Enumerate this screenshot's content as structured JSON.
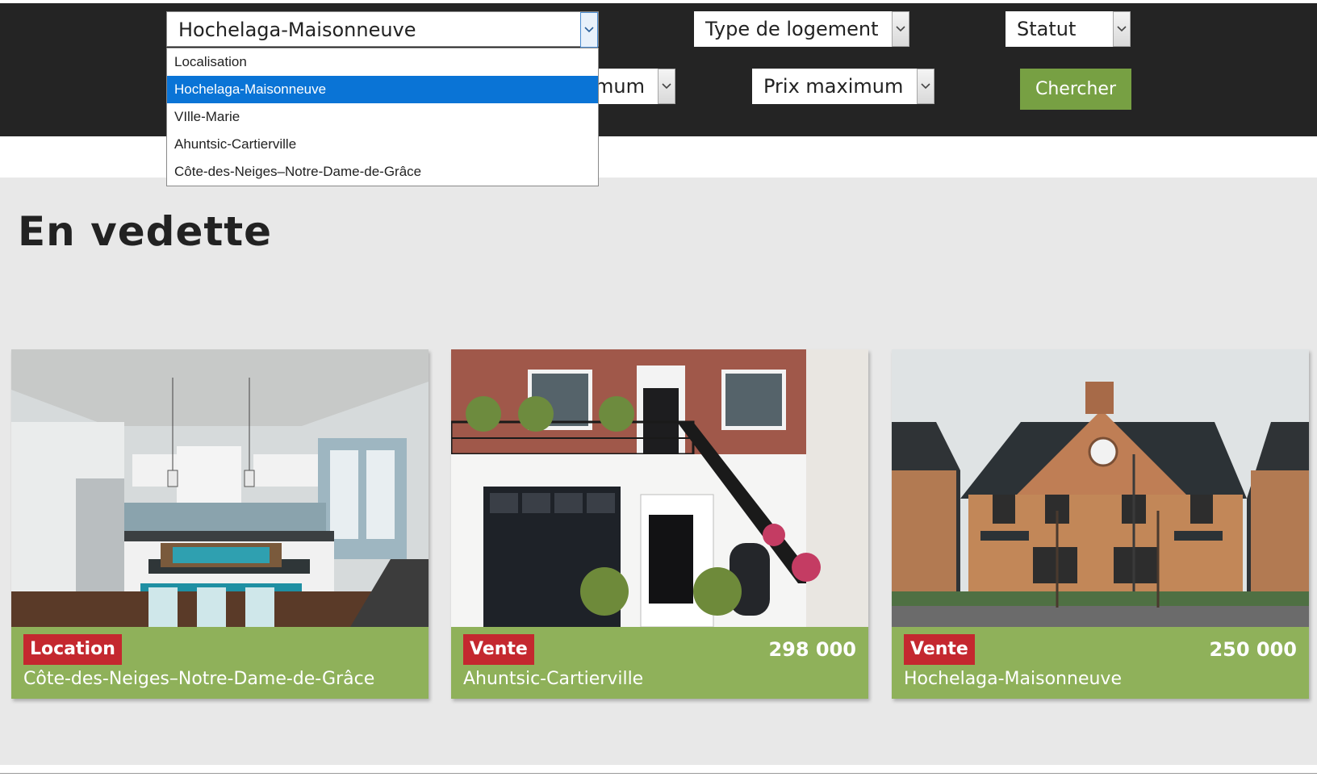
{
  "filters": {
    "location": {
      "value": "Hochelaga-Maisonneuve",
      "options": [
        "Localisation",
        "Hochelaga-Maisonneuve",
        "VIlle-Marie",
        "Ahuntsic-Cartierville",
        "Côte-des-Neiges–Notre-Dame-de-Grâce"
      ],
      "highlighted_index": 1
    },
    "type": {
      "value": "Type de logement"
    },
    "status": {
      "value": "Statut"
    },
    "min_price": {
      "visible_fragment": "mum"
    },
    "max_price": {
      "value": "Prix maximum"
    },
    "search_label": "Chercher"
  },
  "featured": {
    "heading": "En vedette",
    "cards": [
      {
        "badge": "Location",
        "price": "",
        "location": "Côte-des-Neiges–Notre-Dame-de-Grâce",
        "image": "kitchen-interior"
      },
      {
        "badge": "Vente",
        "price": "298 000",
        "location": "Ahuntsic-Cartierville",
        "image": "brick-townhouse"
      },
      {
        "badge": "Vente",
        "price": "250 000",
        "location": "Hochelaga-Maisonneuve",
        "image": "suburban-brick-house"
      }
    ]
  },
  "colors": {
    "header_bg": "#242424",
    "page_bg": "#e8e8e8",
    "search_button": "#77a043",
    "card_info_bg": "#8fb15a",
    "badge_bg": "#c4282f",
    "dropdown_highlight": "#0a74d6"
  }
}
